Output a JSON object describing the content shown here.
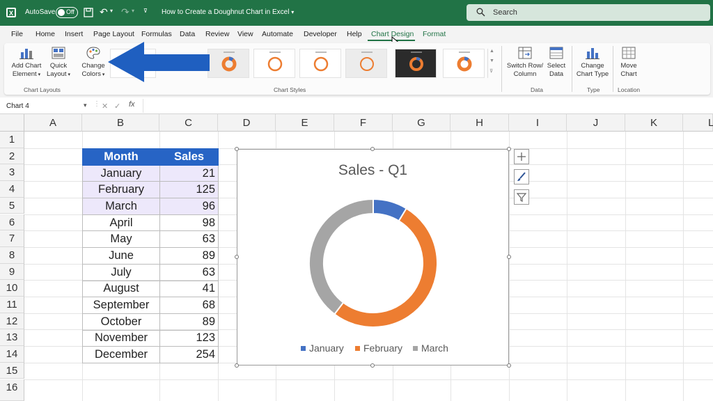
{
  "titlebar": {
    "autosave_label": "AutoSave",
    "autosave_state": "Off",
    "doc_title": "How to Create a Doughnut Chart in Excel",
    "search_placeholder": "Search"
  },
  "menu": {
    "tabs": [
      "File",
      "Home",
      "Insert",
      "Page Layout",
      "Formulas",
      "Data",
      "Review",
      "View",
      "Automate",
      "Developer",
      "Help",
      "Chart Design",
      "Format"
    ],
    "active_tab": "Chart Design"
  },
  "ribbon": {
    "add_chart_element": [
      "Add Chart",
      "Element"
    ],
    "quick_layout": [
      "Quick",
      "Layout"
    ],
    "change_colors": [
      "Change",
      "Colors"
    ],
    "switch_row_column": [
      "Switch Row/",
      "Column"
    ],
    "select_data": [
      "Select",
      "Data"
    ],
    "change_chart_type": [
      "Change",
      "Chart Type"
    ],
    "move_chart": [
      "Move",
      "Chart"
    ],
    "groups": {
      "chart_layouts": "Chart Layouts",
      "chart_styles": "Chart Styles",
      "data": "Data",
      "type": "Type",
      "location": "Location"
    }
  },
  "formula_bar": {
    "name_box": "Chart 4",
    "fx": "fx"
  },
  "sheet": {
    "columns": [
      "A",
      "B",
      "C",
      "D",
      "E",
      "F",
      "G",
      "H",
      "I",
      "J",
      "K",
      "L"
    ],
    "rows": [
      "1",
      "2",
      "3",
      "4",
      "5",
      "6",
      "7",
      "8",
      "9",
      "10",
      "11",
      "12",
      "13",
      "14",
      "15",
      "16"
    ],
    "table": {
      "header": [
        "Month",
        "Sales"
      ],
      "rows": [
        [
          "January",
          "21"
        ],
        [
          "February",
          "125"
        ],
        [
          "March",
          "96"
        ],
        [
          "April",
          "98"
        ],
        [
          "May",
          "63"
        ],
        [
          "June",
          "89"
        ],
        [
          "July",
          "63"
        ],
        [
          "August",
          "41"
        ],
        [
          "September",
          "68"
        ],
        [
          "October",
          "89"
        ],
        [
          "November",
          "123"
        ],
        [
          "December",
          "254"
        ]
      ]
    }
  },
  "chart_data": {
    "type": "pie",
    "variant": "doughnut",
    "title": "Sales - Q1",
    "categories": [
      "January",
      "February",
      "March"
    ],
    "values": [
      21,
      125,
      96
    ],
    "colors": [
      "#4472c4",
      "#ed7d31",
      "#a5a5a5"
    ],
    "legend_position": "bottom"
  },
  "colors": {
    "excel_green": "#217346",
    "table_header": "#2764c5",
    "arrow_blue": "#1f5fc0"
  }
}
